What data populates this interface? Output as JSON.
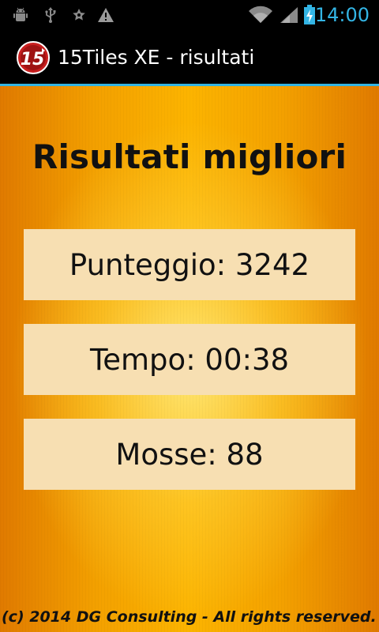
{
  "status_bar": {
    "icons": [
      "android-debug-icon",
      "usb-icon",
      "star-icon",
      "warning-icon"
    ],
    "right_icons": [
      "wifi-icon",
      "signal-icon",
      "battery-charging-icon"
    ],
    "time": "14:00",
    "accent_color": "#33b5e5"
  },
  "action_bar": {
    "logo_text": "15",
    "title": "15Tiles XE - risultati"
  },
  "main": {
    "title": "Risultati migliori",
    "results": [
      {
        "label": "Punteggio",
        "value": "3242"
      },
      {
        "label": "Tempo",
        "value": "00:38"
      },
      {
        "label": "Mosse",
        "value": "88"
      }
    ],
    "footer": "(c) 2014 DG Consulting - All rights reserved."
  }
}
